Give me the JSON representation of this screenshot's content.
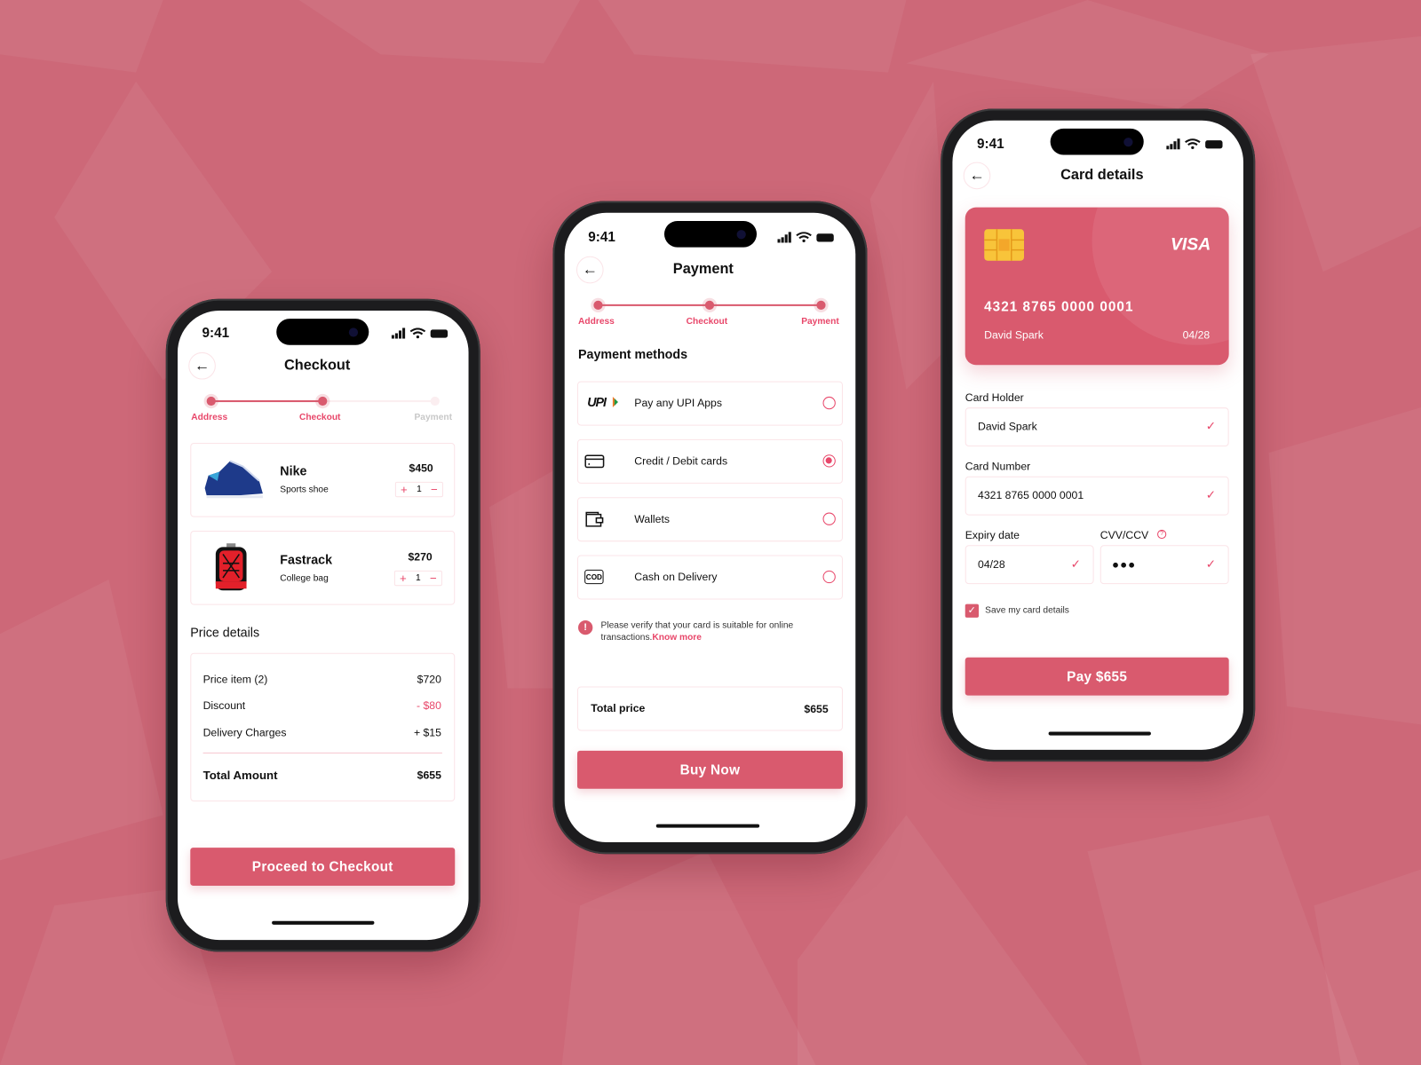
{
  "colors": {
    "background": "#cd6878",
    "accent": "#d95a6e",
    "accent_text": "#e8476a"
  },
  "status_bar": {
    "time": "9:41",
    "icons": [
      "signal-icon",
      "wifi-icon",
      "battery-icon"
    ]
  },
  "checkout": {
    "title": "Checkout",
    "steps": [
      {
        "label": "Address",
        "done": true
      },
      {
        "label": "Checkout",
        "done": true
      },
      {
        "label": "Payment",
        "done": false
      }
    ],
    "items": [
      {
        "name": "Nike",
        "subtitle": "Sports shoe",
        "price": "$450",
        "qty": "1",
        "image": "shoe-image"
      },
      {
        "name": "Fastrack",
        "subtitle": "College bag",
        "price": "$270",
        "qty": "1",
        "image": "backpack-image"
      }
    ],
    "price_details_heading": "Price details",
    "price_rows": [
      {
        "label": "Price item (2)",
        "value": "$720"
      },
      {
        "label": "Discount",
        "value": "- $80"
      },
      {
        "label": "Delivery Charges",
        "value": "+ $15"
      }
    ],
    "total_label": "Total Amount",
    "total_value": "$655",
    "cta": "Proceed to Checkout"
  },
  "payment": {
    "title": "Payment",
    "steps": [
      {
        "label": "Address",
        "done": true
      },
      {
        "label": "Checkout",
        "done": true
      },
      {
        "label": "Payment",
        "done": true
      }
    ],
    "methods_heading": "Payment methods",
    "methods": [
      {
        "label": "Pay any UPI Apps",
        "icon": "upi-logo",
        "selected": false,
        "icon_text": "UPI"
      },
      {
        "label": "Credit / Debit cards",
        "icon": "credit-card-icon",
        "selected": true
      },
      {
        "label": "Wallets",
        "icon": "wallet-icon",
        "selected": false
      },
      {
        "label": "Cash on Delivery",
        "icon": "cod-icon",
        "selected": false,
        "icon_text": "COD"
      }
    ],
    "notice": "Please verify that your card is suitable for online",
    "notice_line2": "transactions.",
    "notice_link": "Know more",
    "total_label": "Total price",
    "total_value": "$655",
    "cta": "Buy Now"
  },
  "card_details": {
    "title": "Card details",
    "card": {
      "brand": "VISA",
      "number": "4321 8765 0000 0001",
      "holder": "David Spark",
      "expiry": "04/28"
    },
    "fields": {
      "holder_label": "Card Holder",
      "holder_value": "David Spark",
      "number_label": "Card Number",
      "number_value": "4321 8765 0000 0001",
      "expiry_label": "Expiry date",
      "expiry_value": "04/28",
      "cvv_label": "CVV/CCV",
      "cvv_value": "●●●"
    },
    "save_label": "Save my card details",
    "save_checked": true,
    "cta": "Pay $655"
  }
}
